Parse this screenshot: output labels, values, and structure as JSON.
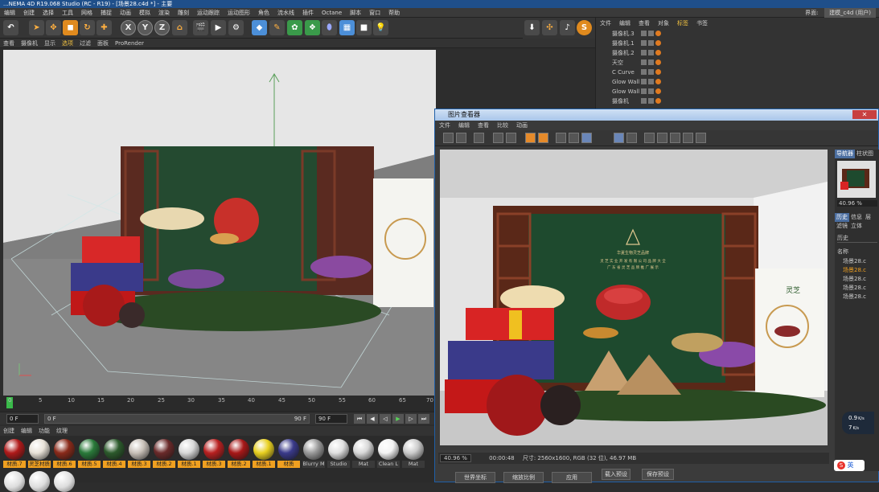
{
  "window": {
    "title": "...NEMA 4D R19.068 Studio (RC - R19) - [场景28.c4d *] - 主要"
  },
  "menubar": {
    "items": [
      "编辑",
      "创建",
      "选择",
      "工具",
      "网格",
      "捕捉",
      "动画",
      "模拟",
      "渲染",
      "雕刻",
      "运动跟踪",
      "运动图形",
      "角色",
      "流水线",
      "插件",
      "Octane",
      "脚本",
      "窗口",
      "帮助"
    ],
    "layout_label": "界面:",
    "layout_value": "建模_c4d (用户)"
  },
  "toolbar": {
    "xyz": [
      "X",
      "Y",
      "Z"
    ]
  },
  "viewport_menu": {
    "items": [
      "查看",
      "摄像机",
      "显示",
      "选项",
      "过滤",
      "面板",
      "ProRender"
    ],
    "active": "选项"
  },
  "timeline": {
    "ticks": [
      "0",
      "5",
      "10",
      "15",
      "20",
      "25",
      "30",
      "35",
      "40",
      "45",
      "50",
      "55",
      "60",
      "65",
      "70"
    ],
    "current_frame": "0",
    "start_field": "0 F",
    "range_left": "0 F",
    "range_right": "90 F",
    "end_field": "90 F"
  },
  "material_menu": {
    "items": [
      "创建",
      "编辑",
      "功能",
      "纹理"
    ]
  },
  "materials": [
    {
      "label": "材质.7",
      "color": "#b01a1a"
    },
    {
      "label": "灵芝材质",
      "color": "#e8e2d8"
    },
    {
      "label": "材质.6",
      "color": "#8a2a1a"
    },
    {
      "label": "材质.5",
      "color": "#2a7a3a"
    },
    {
      "label": "材质.4",
      "color": "#2c5a2c"
    },
    {
      "label": "材质.3",
      "color": "#c8c0b8"
    },
    {
      "label": "材质.2",
      "color": "#6a2a2a"
    },
    {
      "label": "材质.1",
      "color": "#d8d8d8"
    },
    {
      "label": "材质.3",
      "color": "#b82020"
    },
    {
      "label": "材质.2",
      "color": "#a81818"
    },
    {
      "label": "材质.1",
      "color": "#e8d020"
    },
    {
      "label": "材质",
      "color": "#3a3a8a"
    },
    {
      "label": "Blurry M",
      "color": "#9a9a9a"
    },
    {
      "label": "Studio",
      "color": "#e0e0e0"
    },
    {
      "label": "Mat",
      "color": "#d8d8d8"
    },
    {
      "label": "Clean L",
      "color": "#f4f4f4"
    },
    {
      "label": "Mat",
      "color": "#cccccc"
    }
  ],
  "object_manager": {
    "menu": [
      "文件",
      "编辑",
      "查看",
      "对象",
      "标签",
      "书签"
    ],
    "active_menu": "标签",
    "objects": [
      "摄像机.3",
      "摄像机.1",
      "摄像机.2",
      "天空",
      "C Curve",
      "Glow Wall",
      "Glow Wall",
      "摄像机"
    ]
  },
  "picture_viewer": {
    "title": "图片查看器",
    "menu": [
      "文件",
      "编辑",
      "查看",
      "比较",
      "动画"
    ],
    "zoom": "40.96 %",
    "time": "00:00:48",
    "info": "尺寸: 2560x1600, RGB (32 位), 46.97 MB",
    "side_tabs_top": [
      "导航器",
      "柱状图"
    ],
    "side_zoom": "40.96 %",
    "side_tabs": [
      "历史",
      "信息",
      "层",
      "滤镜",
      "立体"
    ],
    "history_label": "历史",
    "name_header": "名称",
    "history_items": [
      "场景28.c",
      "场景28.c",
      "场景28.c",
      "场景28.c",
      "场景28.c"
    ],
    "bottom_buttons": [
      "载入预设",
      "保存预设",
      "应用"
    ],
    "bottom_dropdowns": [
      "世界坐标",
      "缩放比例"
    ]
  },
  "render_scene": {
    "brand_text": "华夏生物灵芝品牌",
    "headline_1": "灵 芝 实 业 开 发 有 限 公 司 品 牌 大 全",
    "headline_2": "广 东 省 灵 芝 品 牌 推 广 展 示",
    "box_label": "灵芝"
  },
  "speed_widget": {
    "up": "0.9",
    "up_unit": "K/s",
    "down": "7",
    "down_unit": "K/s"
  },
  "ime": {
    "label": "英"
  },
  "colors": {
    "accent": "#f0a020",
    "title_blue": "#1f4f8a",
    "bg": "#2d2d2d"
  }
}
